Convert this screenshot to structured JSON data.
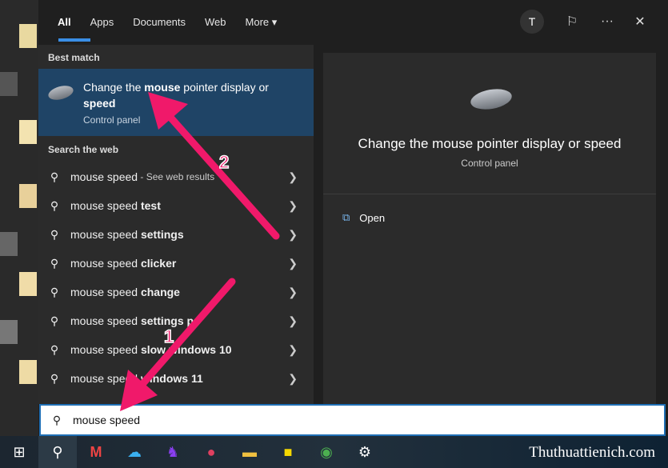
{
  "tabs": [
    {
      "label": "All",
      "active": true
    },
    {
      "label": "Apps"
    },
    {
      "label": "Documents"
    },
    {
      "label": "Web"
    },
    {
      "label": "More ▾"
    }
  ],
  "top_right": {
    "avatar": "T",
    "feedback_icon": "feedback-icon",
    "more": "···",
    "close": "✕"
  },
  "best_match": {
    "heading": "Best match",
    "title_parts": [
      "Change the ",
      "mouse",
      " pointer display or ",
      "speed"
    ],
    "subtitle": "Control panel"
  },
  "web": {
    "heading": "Search the web",
    "items": [
      {
        "normal": "mouse speed",
        "bold": "",
        "suffix": " - See web results"
      },
      {
        "normal": "mouse speed ",
        "bold": "test"
      },
      {
        "normal": "mouse speed ",
        "bold": "settings"
      },
      {
        "normal": "mouse speed ",
        "bold": "clicker"
      },
      {
        "normal": "mouse speed ",
        "bold": "change"
      },
      {
        "normal": "mouse speed ",
        "bold": "settings pc"
      },
      {
        "normal": "mouse speed ",
        "bold": "slow windows 10"
      },
      {
        "normal": "mouse speed ",
        "bold": "windows 11"
      }
    ]
  },
  "preview": {
    "title": "Change the mouse pointer display or speed",
    "subtitle": "Control panel",
    "action": "Open"
  },
  "search": {
    "value": "mouse speed"
  },
  "annotations": {
    "one": "1",
    "two": "2",
    "color": "#f0196a"
  },
  "watermark": "Thuthuattienich.com",
  "accent": "#1f4466"
}
